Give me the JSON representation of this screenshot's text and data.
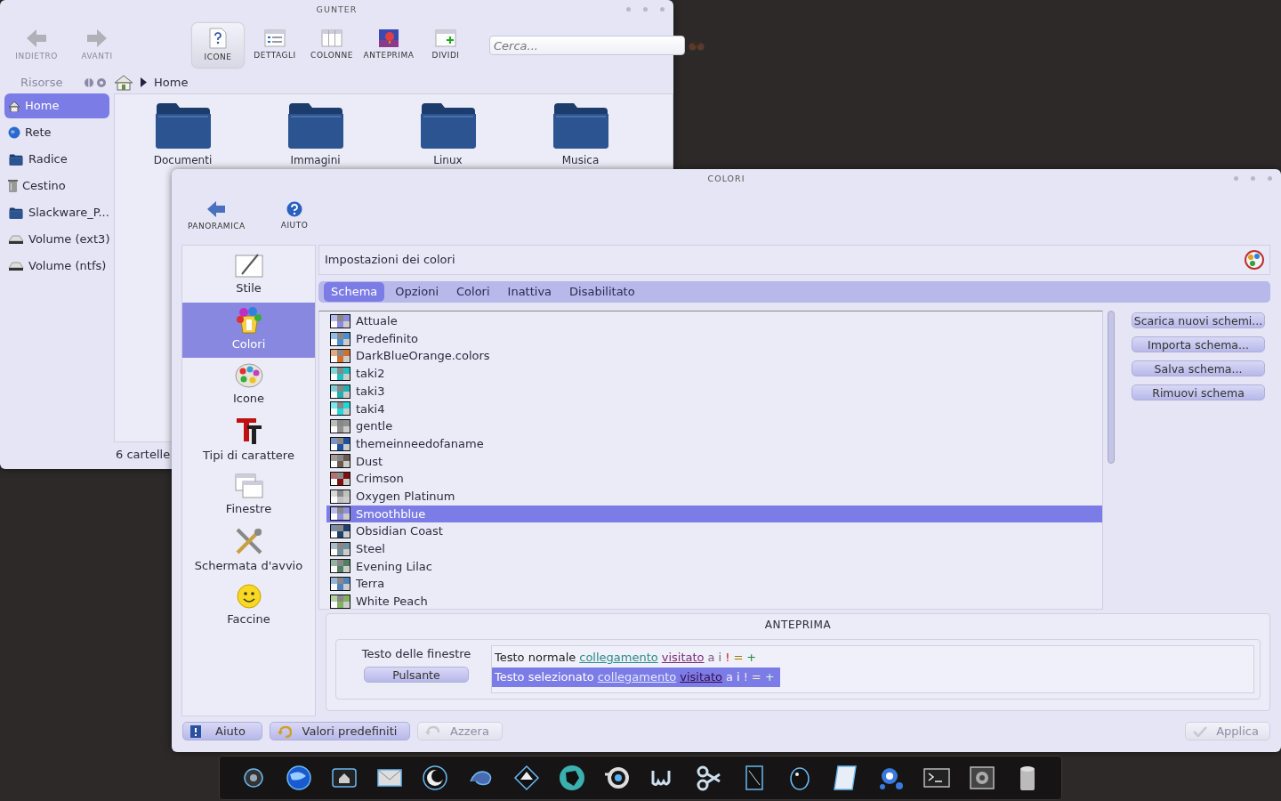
{
  "file_manager": {
    "title": "GUNTER",
    "toolbar": [
      {
        "label": "INDIETRO",
        "selected": false,
        "disabled": true
      },
      {
        "label": "AVANTI",
        "selected": false,
        "disabled": true
      },
      {
        "label": "ICONE",
        "selected": true,
        "disabled": false
      },
      {
        "label": "DETTAGLI",
        "selected": false,
        "disabled": false
      },
      {
        "label": "COLONNE",
        "selected": false,
        "disabled": false
      },
      {
        "label": "ANTEPRIMA",
        "selected": false,
        "disabled": false
      },
      {
        "label": "DIVIDI",
        "selected": false,
        "disabled": false
      }
    ],
    "search": {
      "placeholder": "Cerca..."
    },
    "sidebar": {
      "title": "Risorse",
      "items": [
        {
          "label": "Home",
          "selected": true
        },
        {
          "label": "Rete",
          "selected": false
        },
        {
          "label": "Radice",
          "selected": false
        },
        {
          "label": "Cestino",
          "selected": false
        },
        {
          "label": "Slackware_P...",
          "selected": false
        },
        {
          "label": "Volume (ext3)",
          "selected": false
        },
        {
          "label": "Volume (ntfs)",
          "selected": false
        }
      ]
    },
    "breadcrumb": [
      "Home"
    ],
    "folders": [
      {
        "name": "Documenti"
      },
      {
        "name": "Immagini"
      },
      {
        "name": "Linux"
      },
      {
        "name": "Musica"
      }
    ],
    "status_bar": "6 cartelle"
  },
  "colors_window": {
    "title": "COLORI",
    "toolbar": [
      {
        "label": "PANORAMICA"
      },
      {
        "label": "AIUTO"
      }
    ],
    "categories": [
      {
        "label": "Stile",
        "selected": false
      },
      {
        "label": "Colori",
        "selected": true
      },
      {
        "label": "Icone",
        "selected": false
      },
      {
        "label": "Tipi di carattere",
        "selected": false
      },
      {
        "label": "Finestre",
        "selected": false
      },
      {
        "label": "Schermata d'avvio",
        "selected": false
      },
      {
        "label": "Faccine",
        "selected": false
      }
    ],
    "header": "Impostazioni dei colori",
    "tabs": [
      {
        "label": "Schema",
        "selected": true
      },
      {
        "label": "Opzioni",
        "selected": false
      },
      {
        "label": "Colori",
        "selected": false
      },
      {
        "label": "Inattiva",
        "selected": false
      },
      {
        "label": "Disabilitato",
        "selected": false
      }
    ],
    "schemes": [
      {
        "name": "Attuale",
        "color": "#8a8ae0",
        "selected": false
      },
      {
        "name": "Predefinito",
        "color": "#4a90d0",
        "selected": false
      },
      {
        "name": "DarkBlueOrange.colors",
        "color": "#d07030",
        "selected": false
      },
      {
        "name": "taki2",
        "color": "#20c0c0",
        "selected": false
      },
      {
        "name": "taki3",
        "color": "#20b0b0",
        "selected": false
      },
      {
        "name": "taki4",
        "color": "#20d8d8",
        "selected": false
      },
      {
        "name": "gentle",
        "color": "#909090",
        "selected": false
      },
      {
        "name": "themeinneedofaname",
        "color": "#2050a0",
        "selected": false
      },
      {
        "name": "Dust",
        "color": "#6a5a50",
        "selected": false
      },
      {
        "name": "Crimson",
        "color": "#801010",
        "selected": false
      },
      {
        "name": "Oxygen Platinum",
        "color": "#c0c0c0",
        "selected": false
      },
      {
        "name": "Smoothblue",
        "color": "#9090e0",
        "selected": true
      },
      {
        "name": "Obsidian Coast",
        "color": "#204070",
        "selected": false
      },
      {
        "name": "Steel",
        "color": "#7090a0",
        "selected": false
      },
      {
        "name": "Evening Lilac",
        "color": "#508060",
        "selected": false
      },
      {
        "name": "Terra",
        "color": "#5080c0",
        "selected": false
      },
      {
        "name": "White Peach",
        "color": "#80b060",
        "selected": false
      }
    ],
    "actions": [
      "Scarica nuovi schemi...",
      "Importa schema...",
      "Salva schema...",
      "Rimuovi schema"
    ],
    "preview": {
      "title": "ANTEPRIMA",
      "window_text": "Testo delle finestre",
      "button": "Pulsante",
      "normal_line": [
        {
          "text": "Testo normale",
          "kind": "plain"
        },
        {
          "text": "collegamento",
          "kind": "link"
        },
        {
          "text": "visitato",
          "kind": "visited"
        },
        {
          "text": "a",
          "kind": "active"
        },
        {
          "text": "i",
          "kind": "inactive"
        },
        {
          "text": "!",
          "kind": "negative"
        },
        {
          "text": "=",
          "kind": "neutral"
        },
        {
          "text": "+",
          "kind": "positive"
        }
      ],
      "selected_line": [
        {
          "text": "Testo selezionato",
          "kind": "plain"
        },
        {
          "text": "collegamento",
          "kind": "link"
        },
        {
          "text": "visitato",
          "kind": "visited"
        },
        {
          "text": "a",
          "kind": "active"
        },
        {
          "text": "i",
          "kind": "inactive"
        },
        {
          "text": "!",
          "kind": "negative"
        },
        {
          "text": "=",
          "kind": "neutral"
        },
        {
          "text": "+",
          "kind": "positive"
        }
      ]
    },
    "footer_buttons": [
      {
        "label": "Aiuto",
        "disabled": false
      },
      {
        "label": "Valori predefiniti",
        "disabled": false
      },
      {
        "label": "Azzera",
        "disabled": true
      },
      {
        "label": "Applica",
        "disabled": true
      }
    ]
  }
}
